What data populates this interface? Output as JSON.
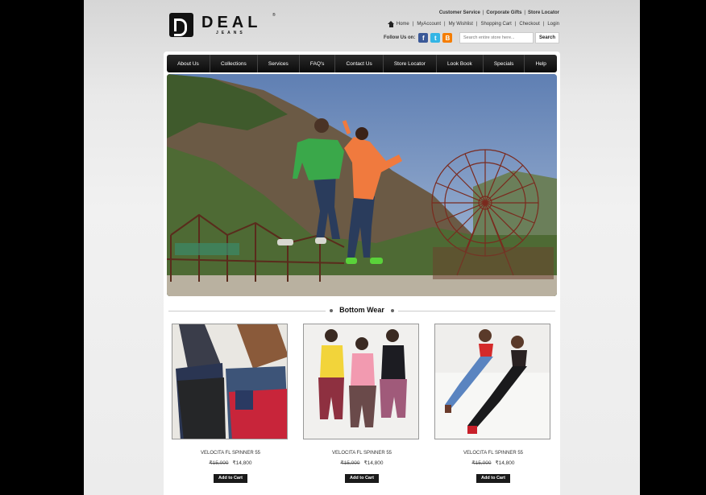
{
  "brand": {
    "name": "DEAL",
    "sub": "JEANS",
    "reg": "®"
  },
  "top_links": [
    "Customer Service",
    "Corporate Gifts",
    "Store Locator"
  ],
  "account_links": [
    "Home",
    "MyAccount",
    "My Wishlist",
    "Shopping Cart",
    "Checkout",
    "Login"
  ],
  "follow": {
    "label": "Follow Us on:",
    "icons": [
      "facebook-icon",
      "twitter-icon",
      "blogger-icon"
    ]
  },
  "search": {
    "placeholder": "Search entire store here...",
    "button": "Search"
  },
  "nav": [
    "About Us",
    "Collections",
    "Services",
    "FAQ's",
    "Contact Us",
    "Store Locator",
    "Look Book",
    "Specials",
    "Help"
  ],
  "section": {
    "title": "Bottom Wear"
  },
  "products": [
    {
      "name": "VELOCITA FL SPINNER 55",
      "old_price": "₹15,000",
      "price": "₹14,800",
      "cta": "Add to Cart"
    },
    {
      "name": "VELOCITA FL SPINNER 55",
      "old_price": "₹15,000",
      "price": "₹14,800",
      "cta": "Add to Cart"
    },
    {
      "name": "VELOCITA FL SPINNER 55",
      "old_price": "₹15,000",
      "price": "₹14,800",
      "cta": "Add to Cart"
    }
  ],
  "colors": {
    "nav_bg": "#111111",
    "facebook": "#3b5998",
    "twitter": "#33b5e5",
    "blogger": "#f57d00"
  }
}
